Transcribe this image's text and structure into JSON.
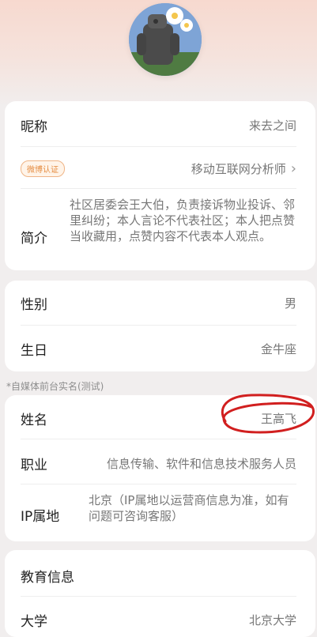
{
  "profile": {
    "nickname_label": "昵称",
    "nickname_value": "来去之间",
    "badge": "微博认证",
    "certification": "移动互联网分析师",
    "bio_label": "简介",
    "bio_text": "社区居委会王大伯，负责接诉物业投诉、邻里纠纷；本人言论不代表社区；本人把点赞当收藏用，点赞内容不代表本人观点。"
  },
  "basic": {
    "gender_label": "性别",
    "gender_value": "男",
    "birthday_label": "生日",
    "birthday_value": "金牛座"
  },
  "realname_note": "*自媒体前台实名(测试)",
  "realname": {
    "name_label": "姓名",
    "name_value": "王高飞",
    "job_label": "职业",
    "job_value": "信息传输、软件和信息技术服务人员",
    "ip_label": "IP属地",
    "ip_value": "北京（IP属地以运营商信息为准，如有问题可咨询客服）"
  },
  "education": {
    "title": "教育信息",
    "university_label": "大学",
    "university_value": "北京大学"
  },
  "icons": {
    "chevron": "chevron-right-icon",
    "avatar": "robot-avatar"
  }
}
